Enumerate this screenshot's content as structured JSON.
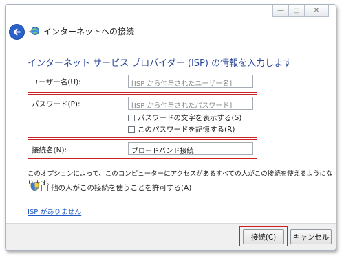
{
  "window": {
    "title": "インターネットへの接続",
    "controls": {
      "minimize": "—",
      "maximize": "□",
      "close": "✕"
    }
  },
  "heading": "インターネット サービス プロバイダー (ISP) の情報を入力します",
  "fields": {
    "username": {
      "label": "ユーザー名(U):",
      "placeholder": "[ISP から付与されたユーザー名]"
    },
    "password": {
      "label": "パスワード(P):",
      "placeholder": "[ISP から付与されたパスワード]"
    },
    "connection_name": {
      "label": "接続名(N):",
      "value": "ブロードバンド接続"
    }
  },
  "checkboxes": {
    "show_password": {
      "label": "パスワードの文字を表示する(S)",
      "checked": false
    },
    "remember_password": {
      "label": "このパスワードを記憶する(R)",
      "checked": false
    },
    "allow_others": {
      "label": "他の人がこの接続を使うことを許可する(A)",
      "checked": false
    }
  },
  "note": "このオプションによって、このコンピューターにアクセスがあるすべての人がこの接続を使えるようになります。",
  "link": "ISP がありません",
  "buttons": {
    "connect": "接続(C)",
    "cancel": "キャンセル"
  },
  "colors": {
    "heading": "#2d4a9a",
    "highlight_box": "#cc2121",
    "link": "#1f57c7",
    "back_button": "#2a62c9"
  },
  "icons": {
    "back": "back-arrow-icon",
    "network": "network-globe-icon",
    "uac": "uac-shield-icon"
  }
}
